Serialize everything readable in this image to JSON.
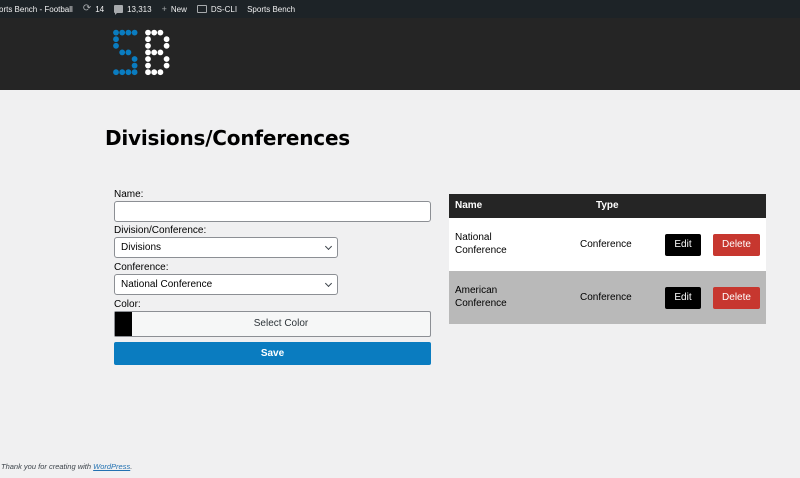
{
  "admin_bar": {
    "site_title": "orts Bench - Football",
    "updates_count": "14",
    "comments_count": "13,313",
    "new_label": "New",
    "plugin_label": "DS-CLI",
    "site_link": "Sports Bench"
  },
  "header": {
    "logo_text": "SB",
    "logo_colors": {
      "s": "#0a7cc0",
      "b": "#ffffff"
    }
  },
  "page": {
    "title": "Divisions/Conferences"
  },
  "form": {
    "name_label": "Name:",
    "name_value": "",
    "division_label": "Division/Conference:",
    "division_value": "Divisions",
    "conference_label": "Conference:",
    "conference_value": "National Conference",
    "color_label": "Color:",
    "color_swatch": "#000000",
    "select_color_label": "Select Color",
    "save_label": "Save"
  },
  "table": {
    "headers": [
      "Name",
      "Type"
    ],
    "rows": [
      {
        "name": "National Conference",
        "type": "Conference",
        "edit": "Edit",
        "delete": "Delete"
      },
      {
        "name": "American Conference",
        "type": "Conference",
        "edit": "Edit",
        "delete": "Delete"
      }
    ]
  },
  "footer": {
    "text": "Thank you for creating with ",
    "link": "WordPress",
    "suffix": "."
  },
  "colors": {
    "primary": "#0a7cc0",
    "delete": "#c7372f",
    "header": "#252525",
    "row_alt": "#b9b9b9"
  }
}
